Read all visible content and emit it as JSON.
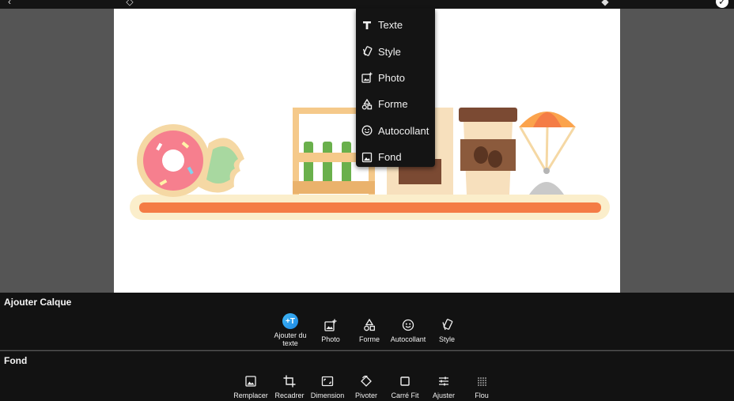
{
  "menu": {
    "items": [
      {
        "label": "Texte",
        "icon": "text-icon"
      },
      {
        "label": "Style",
        "icon": "style-icon"
      },
      {
        "label": "Photo",
        "icon": "add-photo-icon"
      },
      {
        "label": "Forme",
        "icon": "shapes-icon"
      },
      {
        "label": "Autocollant",
        "icon": "sticker-icon"
      },
      {
        "label": "Fond",
        "icon": "background-icon"
      }
    ]
  },
  "calque": {
    "title": "Ajouter Calque",
    "tools": [
      {
        "label": "Ajouter du texte",
        "icon": "add-text-icon",
        "badge": "+T"
      },
      {
        "label": "Photo",
        "icon": "add-photo-icon"
      },
      {
        "label": "Forme",
        "icon": "shapes-icon"
      },
      {
        "label": "Autocollant",
        "icon": "sticker-icon"
      },
      {
        "label": "Style",
        "icon": "style-icon"
      }
    ]
  },
  "fond": {
    "title": "Fond",
    "tools": [
      {
        "label": "Remplacer",
        "icon": "replace-image-icon"
      },
      {
        "label": "Recadrer",
        "icon": "crop-icon"
      },
      {
        "label": "Dimension",
        "icon": "dimension-icon"
      },
      {
        "label": "Pivoter",
        "icon": "rotate-icon"
      },
      {
        "label": "Carré Fit",
        "icon": "square-fit-icon"
      },
      {
        "label": "Ajuster",
        "icon": "adjust-icon"
      },
      {
        "label": "Flou",
        "icon": "blur-icon"
      }
    ]
  },
  "colors": {
    "panel_bg": "#121212",
    "stage_bg": "#555555",
    "accent": "#1e88e5",
    "shelf": "#f47c45"
  }
}
